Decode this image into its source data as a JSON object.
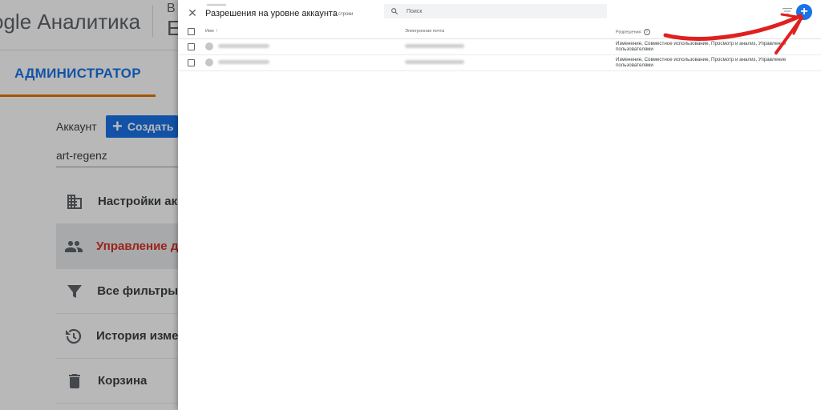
{
  "header": {
    "app_title": "ogle Аналитика",
    "extra_small": "В",
    "extra_large": "E"
  },
  "admin_tab": {
    "label": "АДМИНИСТРАТОР"
  },
  "account": {
    "label": "Аккаунт",
    "create_label": "Создать",
    "name": "art-regenz"
  },
  "menu": [
    {
      "label": "Настройки ак",
      "icon": "building-icon"
    },
    {
      "label": "Управление д",
      "icon": "people-icon",
      "active": true
    },
    {
      "label": "Все фильтры",
      "icon": "filter-icon"
    },
    {
      "label": "История изме",
      "icon": "history-icon"
    },
    {
      "label": "Корзина",
      "icon": "trash-icon"
    }
  ],
  "panel": {
    "title": "Разрешения на уровне аккаунта",
    "row_count": "2 строки",
    "search_placeholder": "Поиск",
    "columns": {
      "name": "Имя",
      "email": "Электронная почта",
      "permissions": "Разрешения"
    },
    "rows": [
      {
        "permissions": "Изменение, Совместное использование, Просмотр и анализ, Управление пользователями"
      },
      {
        "permissions": "Изменение, Совместное использование, Просмотр и анализ, Управление пользователями"
      }
    ]
  },
  "colors": {
    "accent": "#1a73e8",
    "active_item": "#d93025",
    "tab_underline": "#e37400",
    "annotation": "#e0201f"
  }
}
